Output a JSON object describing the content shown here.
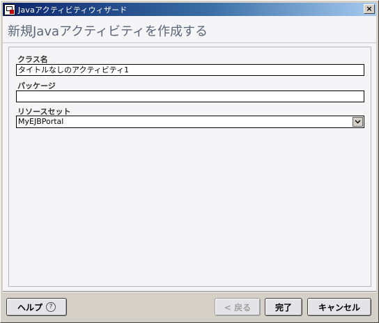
{
  "window": {
    "title": "Javaアクティビティウィザード",
    "close_label": "×",
    "icon": "wizard-app-icon"
  },
  "header": {
    "title": "新規Javaアクティビティを作成する"
  },
  "form": {
    "class_name": {
      "label": "クラス名",
      "value": "タイトルなしのアクティビティ1"
    },
    "package": {
      "label": "パッケージ",
      "value": ""
    },
    "resource_set": {
      "label": "リソースセット",
      "selected": "MyEJBPortal",
      "icon": "chevron-down-icon"
    }
  },
  "footer": {
    "help_label": "ヘルプ",
    "help_icon_glyph": "?",
    "back_label": "< 戻る",
    "finish_label": "完了",
    "cancel_label": "キャンセル"
  }
}
